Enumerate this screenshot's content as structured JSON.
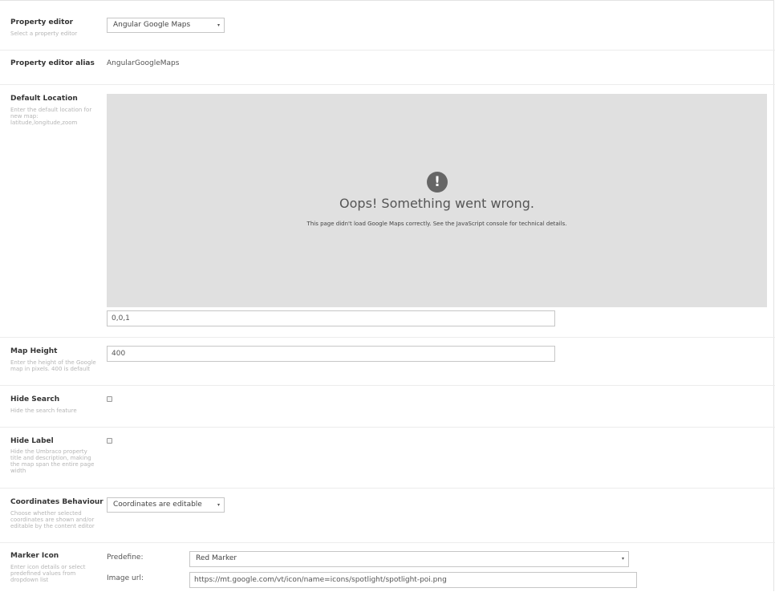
{
  "property_editor": {
    "label": "Property editor",
    "description": "Select a property editor",
    "selected": "Angular Google Maps"
  },
  "property_editor_alias": {
    "label": "Property editor alias",
    "value": "AngularGoogleMaps"
  },
  "default_location": {
    "label": "Default Location",
    "description": "Enter the default location for new map: latitude,longitude,zoom",
    "map_error": {
      "icon": "warning-icon",
      "icon_glyph": "!",
      "title": "Oops! Something went wrong.",
      "message": "This page didn't load Google Maps correctly. See the JavaScript console for technical details."
    },
    "value": "0,0,1"
  },
  "map_height": {
    "label": "Map Height",
    "description": "Enter the height of the Google map in pixels. 400 is default",
    "value": "400"
  },
  "hide_search": {
    "label": "Hide Search",
    "description": "Hide the search feature",
    "checked": false
  },
  "hide_label": {
    "label": "Hide Label",
    "description": "Hide the Umbraco property title and description, making the map span the entire page width",
    "checked": false
  },
  "coordinates_behaviour": {
    "label": "Coordinates Behaviour",
    "description": "Choose whether selected coordinates are shown and/or editable by the content editor",
    "selected": "Coordinates are editable"
  },
  "marker_icon": {
    "label": "Marker Icon",
    "description": "Enter icon details or select predefined values from dropdown list",
    "predefine_label": "Predefine:",
    "predefine_selected": "Red Marker",
    "image_url_label": "Image url:",
    "image_url_value": "https://mt.google.com/vt/icon/name=icons/spotlight/spotlight-poi.png"
  },
  "caret_glyph": "▾"
}
